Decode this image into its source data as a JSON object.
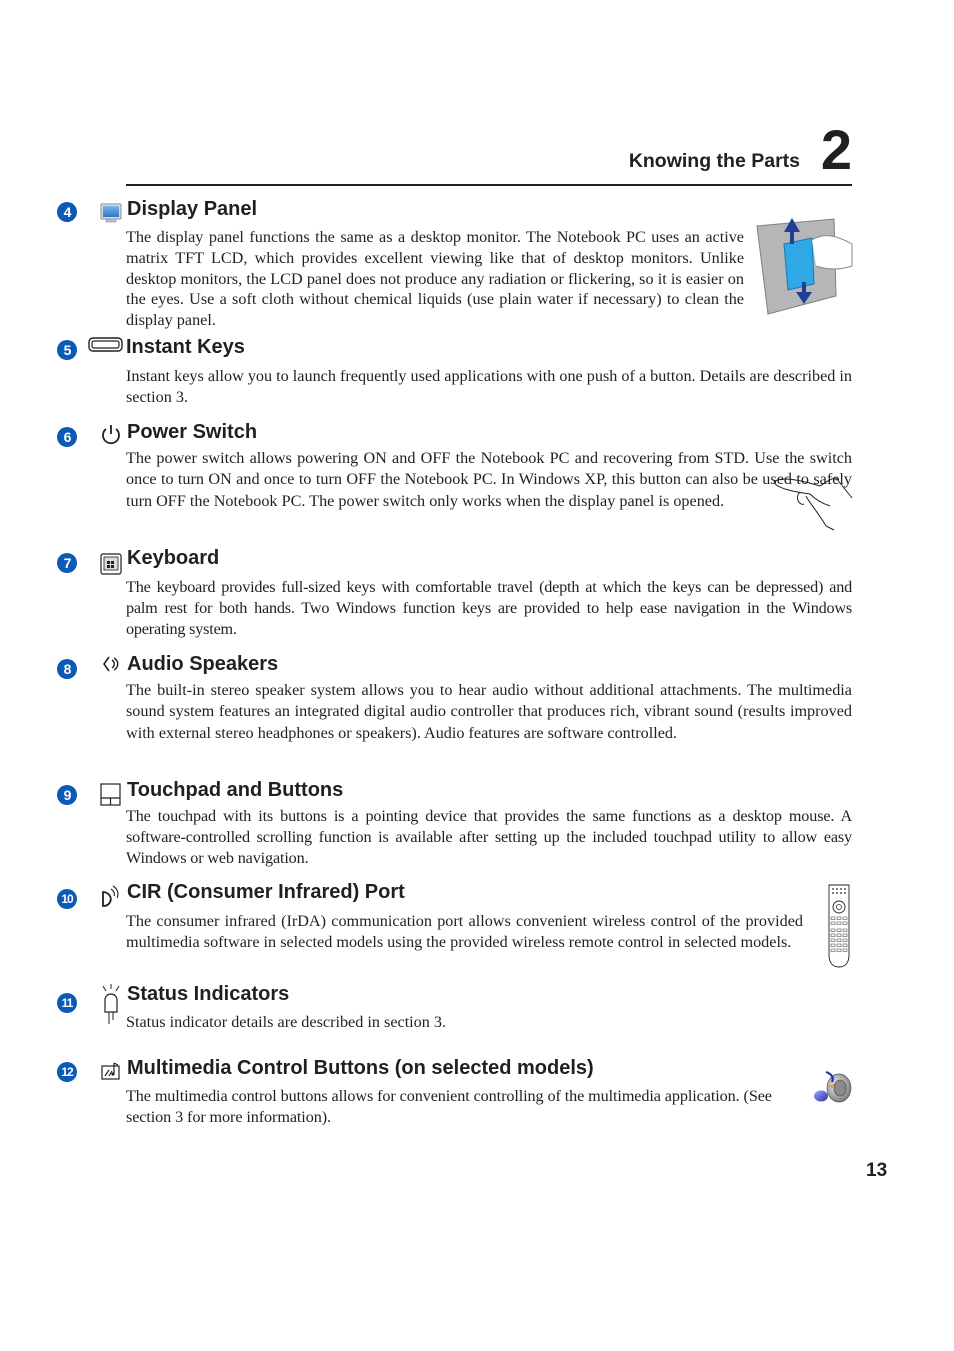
{
  "header": {
    "chapter_title": "Knowing the Parts",
    "chapter_number": "2"
  },
  "sections": [
    {
      "number": "4",
      "icon": "display-icon",
      "title": "Display Panel",
      "body": "The display panel functions the same as a desktop monitor. The Notebook PC uses an active matrix TFT LCD, which provides excellent viewing like that of desktop monitors. Unlike desktop monitors, the LCD panel does not produce any radiation or flickering, so it is easier on the eyes. Use a soft cloth without chemical liquids (use plain water if necessary) to clean the display panel.",
      "illustration": "cleaning-display-illustration"
    },
    {
      "number": "5",
      "icon": "instant-key-icon",
      "title": "Instant Keys",
      "body": "Instant keys allow you to launch frequently used applications with one push of a button. Details are described in section 3."
    },
    {
      "number": "6",
      "icon": "power-icon",
      "title": "Power Switch",
      "body": "The power switch allows powering ON and OFF the Notebook PC and recovering from STD. Use the switch once to turn ON and once to turn OFF the Notebook PC. In Windows XP, this button can also be used to safely turn OFF the Notebook PC. The power switch only works when the display panel is opened.",
      "illustration": "finger-press-illustration"
    },
    {
      "number": "7",
      "icon": "keyboard-icon",
      "title": "Keyboard",
      "body": "The keyboard provides full-sized keys with comfortable travel (depth at which the keys can be depressed) and palm rest for both hands. Two Windows function keys are provided to help ease navigation in the Windows operating system."
    },
    {
      "number": "8",
      "icon": "speaker-icon",
      "title": "Audio Speakers",
      "body": "The built-in stereo speaker system allows you to hear audio without additional attachments. The multimedia sound system features an integrated digital audio controller that produces rich, vibrant sound (results improved with external stereo headphones or speakers). Audio features are software controlled."
    },
    {
      "number": "9",
      "icon": "touchpad-icon",
      "title": "Touchpad and Buttons",
      "body": "The touchpad with its buttons is a pointing device that provides the same functions as a desktop mouse. A software-controlled scrolling function is available after setting up the included touchpad utility to allow easy Windows or web navigation."
    },
    {
      "number": "10",
      "icon": "infrared-icon",
      "title": "CIR (Consumer Infrared) Port",
      "body": "The consumer infrared (IrDA) communication port allows convenient wireless control of the provided multimedia software in selected models using the provided wireless remote control in selected models.",
      "illustration": "remote-control-illustration"
    },
    {
      "number": "11",
      "icon": "led-indicator-icon",
      "title": "Status Indicators",
      "body": "Status indicator details are described in section 3."
    },
    {
      "number": "12",
      "icon": "multimedia-buttons-icon",
      "title": "Multimedia Control Buttons (on selected models)",
      "body": "The multimedia control buttons allows for convenient controlling of the multimedia application. (See section 3 for more information).",
      "illustration": "music-speaker-illustration"
    }
  ],
  "footer": {
    "page_number": "13"
  }
}
